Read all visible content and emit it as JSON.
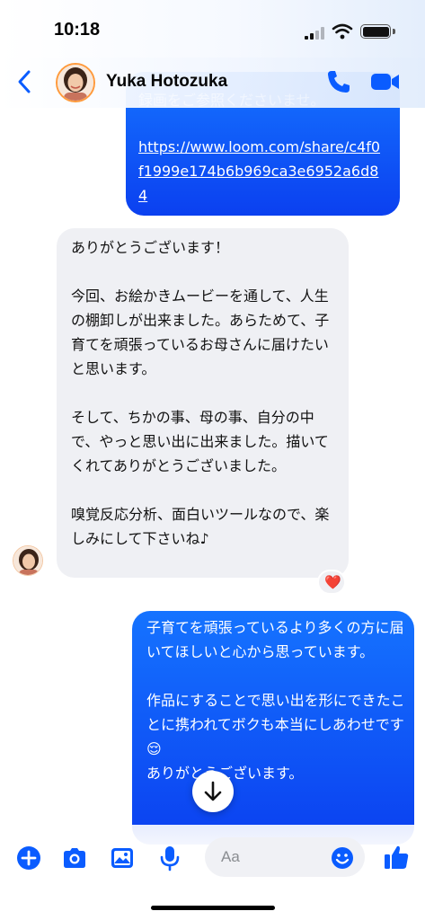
{
  "status": {
    "time": "10:18"
  },
  "header": {
    "contact_name": "Yuka Hotozuka"
  },
  "messages": {
    "sent_1_cut": "録画をご参照くださいませ。",
    "sent_1_link": "https://www.loom.com/share/c4f0f1999e174b6b969ca3e6952a6d84",
    "received_1": "ありがとうございます！\n\n今回、お絵かきムービーを通して、人生の棚卸しが出来ました。あらためて、子育てを頑張っているお母さんに届けたいと思います。\n\nそして、ちかの事、母の事、自分の中で、やっと思い出に出来ました。描いてくれてありがとうございました。\n\n嗅覚反応分析、面白いツールなので、楽しみにして下さいね♪",
    "received_1_reaction": "❤️",
    "sent_2": "子育てを頑張っているより多くの方に届いてほしいと心から思っています。\n\n作品にすることで思い出を形にできたことに携われてボクも本当にしあわせです😌\nありがとうございます。"
  },
  "composer": {
    "placeholder": "Aa"
  },
  "colors": {
    "accent": "#0a5cff",
    "sent_bubble_top": "#1573ff",
    "sent_bubble_bottom": "#0b40f0",
    "received_bubble": "#eff0f4"
  },
  "icons": [
    "back-chevron-icon",
    "phone-icon",
    "video-camera-icon",
    "plus-icon",
    "camera-icon",
    "image-icon",
    "microphone-icon",
    "emoji-icon",
    "thumbs-up-icon",
    "arrow-down-icon"
  ]
}
